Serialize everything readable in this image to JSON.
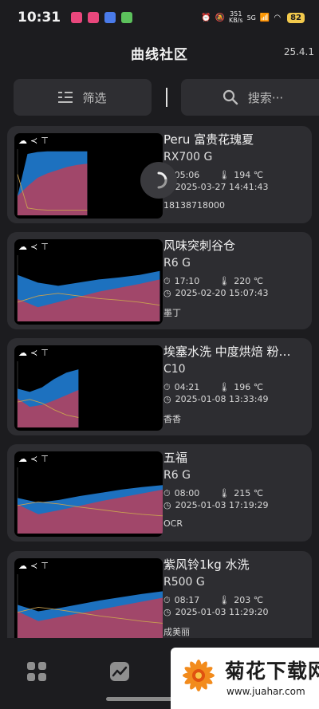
{
  "status_bar": {
    "time": "10:31",
    "net_speed_value": "351",
    "net_speed_unit": "KB/s",
    "signal_label": "5G",
    "battery": "82"
  },
  "header": {
    "title": "曲线社区",
    "version": "25.4.1"
  },
  "toolbar": {
    "filter_label": "筛选",
    "search_label": "搜索···"
  },
  "cards": [
    {
      "bean": "Peru 富贵花瑰夏",
      "machine": "RX700 G",
      "duration": "05:06",
      "temperature": "194 ℃",
      "datetime": "2025-03-27 14:41:43",
      "owner": "18138718000",
      "chart_data": {
        "type": "area",
        "series": [
          {
            "color": "#1f77c9",
            "values": [
              0.3,
              0.95,
              0.98,
              0.99,
              0.99,
              0.99,
              0.99,
              0.99
            ]
          },
          {
            "color": "#b8405a",
            "values": [
              0.3,
              0.45,
              0.58,
              0.65,
              0.7,
              0.75,
              0.78,
              0.8
            ]
          }
        ],
        "x_extent": 0.48
      }
    },
    {
      "bean": "风味突刺谷仓",
      "machine": "R6 G",
      "duration": "17:10",
      "temperature": "220 ℃",
      "datetime": "2025-02-20 15:07:43",
      "owner": "墨丁",
      "chart_data": {
        "type": "area",
        "series": [
          {
            "color": "#1f77c9",
            "values": [
              0.72,
              0.6,
              0.55,
              0.6,
              0.65,
              0.68,
              0.72,
              0.78
            ]
          },
          {
            "color": "#b8405a",
            "values": [
              0.35,
              0.22,
              0.3,
              0.38,
              0.46,
              0.52,
              0.58,
              0.65
            ]
          }
        ],
        "x_extent": 0.98
      }
    },
    {
      "bean": "埃塞水洗 中度烘焙 粉…",
      "machine": "C10",
      "duration": "04:21",
      "temperature": "196 ℃",
      "datetime": "2025-01-08 13:33:49",
      "owner": "香香",
      "chart_data": {
        "type": "area",
        "series": [
          {
            "color": "#1f77c9",
            "values": [
              0.6,
              0.55,
              0.62,
              0.75,
              0.85,
              0.9
            ]
          },
          {
            "color": "#b8405a",
            "values": [
              0.45,
              0.32,
              0.35,
              0.42,
              0.5,
              0.58
            ]
          }
        ],
        "x_extent": 0.42
      }
    },
    {
      "bean": "五福",
      "machine": "R6 G",
      "duration": "08:00",
      "temperature": "215 ℃",
      "datetime": "2025-01-03 17:19:29",
      "owner": "OCR",
      "chart_data": {
        "type": "area",
        "series": [
          {
            "color": "#1f77c9",
            "values": [
              0.55,
              0.48,
              0.52,
              0.58,
              0.63,
              0.68,
              0.72,
              0.75
            ]
          },
          {
            "color": "#b8405a",
            "values": [
              0.45,
              0.3,
              0.36,
              0.43,
              0.5,
              0.56,
              0.62,
              0.68
            ]
          }
        ],
        "x_extent": 1.0
      }
    },
    {
      "bean": "紫风铃1kg 水洗",
      "machine": "R500 G",
      "duration": "08:17",
      "temperature": "203 ℃",
      "datetime": "2025-01-03 11:29:20",
      "owner": "成美丽",
      "chart_data": {
        "type": "area",
        "series": [
          {
            "color": "#1f77c9",
            "values": [
              0.55,
              0.45,
              0.5,
              0.56,
              0.62,
              0.67,
              0.72,
              0.76
            ]
          },
          {
            "color": "#b8405a",
            "values": [
              0.45,
              0.3,
              0.36,
              0.42,
              0.48,
              0.54,
              0.6,
              0.66
            ]
          }
        ],
        "x_extent": 1.0
      }
    }
  ],
  "watermark": {
    "main": "菊花下载网",
    "url": "www.juahar.com"
  },
  "colors": {
    "background": "#1c1c1f",
    "card": "#2d2d31",
    "bt": "#1f77c9",
    "et": "#b8405a",
    "ror": "#c8a050"
  }
}
